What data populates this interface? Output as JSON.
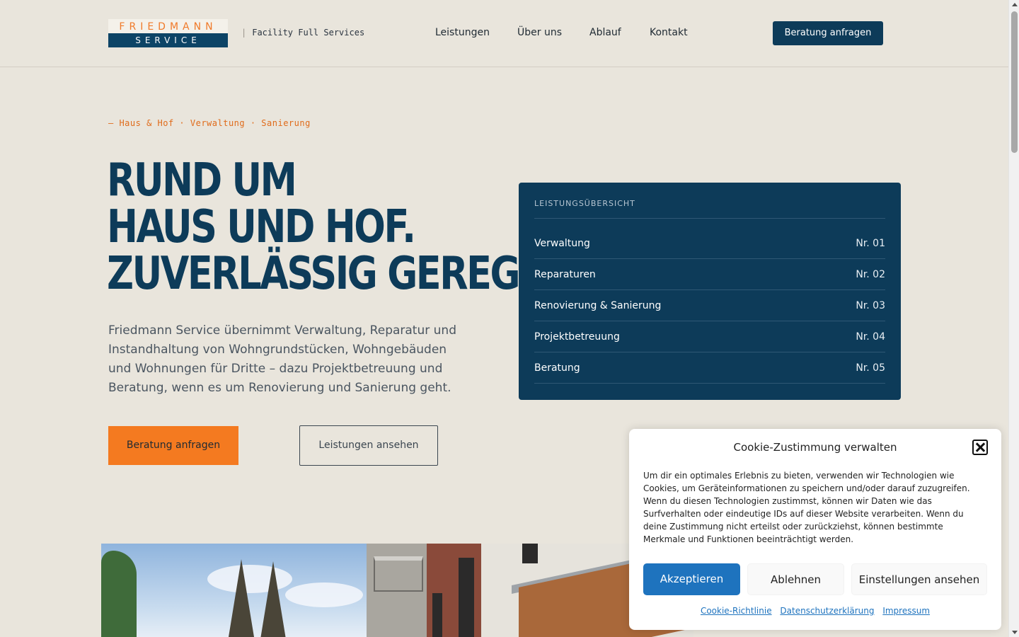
{
  "header": {
    "logo_top": "FRIEDMANN",
    "logo_bottom": "SERVICE",
    "tagline_sep": "|",
    "tagline": "Facility Full Services",
    "nav": [
      "Leistungen",
      "Über uns",
      "Ablauf",
      "Kontakt"
    ],
    "cta": "Beratung anfragen"
  },
  "hero": {
    "eyebrow": "— Haus & Hof · Verwaltung · Sanierung",
    "headline": [
      "RUND UM",
      "HAUS UND HOF.",
      "ZUVERLÄSSIG GEREGELT."
    ],
    "lead": "Friedmann Service übernimmt Verwaltung, Reparatur und Instandhaltung von Wohngrundstücken, Wohngebäuden und Wohnungen für Dritte – dazu Projektbetreuung und Beratung, wenn es um Renovierung und Sanierung geht.",
    "primary_button": "Beratung anfragen",
    "secondary_button": "Leistungen ansehen"
  },
  "panel": {
    "title": "LEISTUNGSÜBERSICHT",
    "items": [
      {
        "label": "Verwaltung",
        "num": "Nr. 01"
      },
      {
        "label": "Reparaturen",
        "num": "Nr. 02"
      },
      {
        "label": "Renovierung & Sanierung",
        "num": "Nr. 03"
      },
      {
        "label": "Projektbetreuung",
        "num": "Nr. 04"
      },
      {
        "label": "Beratung",
        "num": "Nr. 05"
      }
    ]
  },
  "cookie": {
    "title": "Cookie-Zustimmung verwalten",
    "text": "Um dir ein optimales Erlebnis zu bieten, verwenden wir Technologien wie Cookies, um Geräteinformationen zu speichern und/oder darauf zuzugreifen. Wenn du diesen Technologien zustimmst, können wir Daten wie das Surfverhalten oder eindeutige IDs auf dieser Website verarbeiten. Wenn du deine Zustimmung nicht erteilst oder zurückziehst, können bestimmte Merkmale und Funktionen beeinträchtigt werden.",
    "accept": "Akzeptieren",
    "deny": "Ablehnen",
    "view": "Einstellungen ansehen",
    "links": [
      "Cookie-Richtlinie",
      "Datenschutzerklärung",
      "Impressum"
    ]
  },
  "colors": {
    "brand_navy": "#0d3b59",
    "accent_orange": "#f47a20",
    "background": "#e9e5dc",
    "cookie_blue": "#1e73be"
  },
  "icons": {
    "cookie_close": "close-icon"
  }
}
